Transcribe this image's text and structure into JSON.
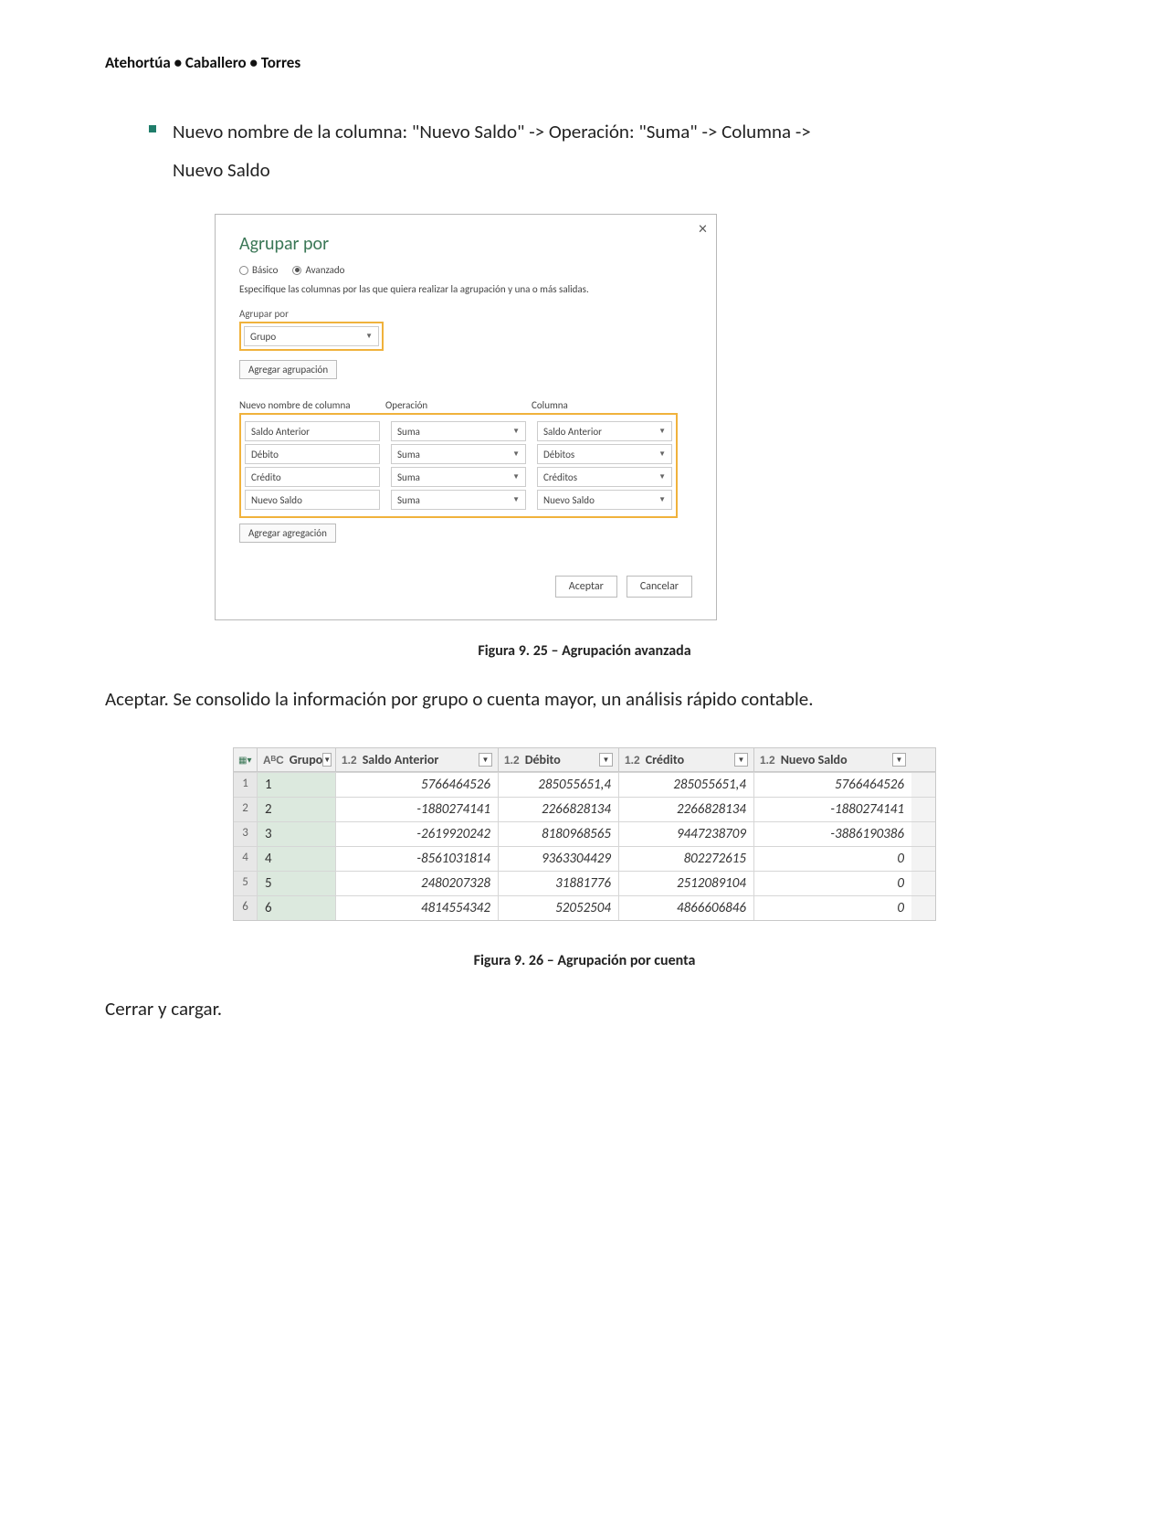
{
  "authors": "Atehortúa • Caballero • Torres",
  "bullet": "Nuevo nombre de la columna: \"Nuevo Saldo\" -> Operación: \"Suma\" -> Columna ->",
  "bullet_cont": "Nuevo Saldo",
  "dialog": {
    "title": "Agrupar por",
    "radio_basic": "Básico",
    "radio_advanced": "Avanzado",
    "desc": "Especifique las columnas por las que quiera realizar la agrupación y una o más salidas.",
    "group_label": "Agrupar por",
    "group_value": "Grupo",
    "add_group_btn": "Agregar agrupación",
    "col_name_header": "Nuevo nombre de columna",
    "col_op_header": "Operación",
    "col_col_header": "Columna",
    "rows": [
      {
        "name": "Saldo Anterior",
        "op": "Suma",
        "col": "Saldo Anterior"
      },
      {
        "name": "Débito",
        "op": "Suma",
        "col": "Débitos"
      },
      {
        "name": "Crédito",
        "op": "Suma",
        "col": "Créditos"
      },
      {
        "name": "Nuevo Saldo",
        "op": "Suma",
        "col": "Nuevo Saldo"
      }
    ],
    "add_agg_btn": "Agregar agregación",
    "accept": "Aceptar",
    "cancel": "Cancelar"
  },
  "caption1": "Figura 9. 25 – Agrupación avanzada",
  "para1": "Aceptar. Se consolido la información por grupo o cuenta mayor, un análisis rápido contable.",
  "table": {
    "columns": {
      "grupo_type": "AᴮC",
      "grupo": "Grupo",
      "num_type": "1.2",
      "saldo": "Saldo Anterior",
      "debito": "Débito",
      "credito": "Crédito",
      "nuevo": "Nuevo Saldo"
    },
    "rows": [
      {
        "i": "1",
        "g": "1",
        "sa": "5766464526",
        "de": "285055651,4",
        "cr": "285055651,4",
        "ns": "5766464526"
      },
      {
        "i": "2",
        "g": "2",
        "sa": "-1880274141",
        "de": "2266828134",
        "cr": "2266828134",
        "ns": "-1880274141"
      },
      {
        "i": "3",
        "g": "3",
        "sa": "-2619920242",
        "de": "8180968565",
        "cr": "9447238709",
        "ns": "-3886190386"
      },
      {
        "i": "4",
        "g": "4",
        "sa": "-8561031814",
        "de": "9363304429",
        "cr": "802272615",
        "ns": "0"
      },
      {
        "i": "5",
        "g": "5",
        "sa": "2480207328",
        "de": "31881776",
        "cr": "2512089104",
        "ns": "0"
      },
      {
        "i": "6",
        "g": "6",
        "sa": "4814554342",
        "de": "52052504",
        "cr": "4866606846",
        "ns": "0"
      }
    ]
  },
  "caption2": "Figura 9. 26 – Agrupación por cuenta",
  "closing": "Cerrar y cargar."
}
